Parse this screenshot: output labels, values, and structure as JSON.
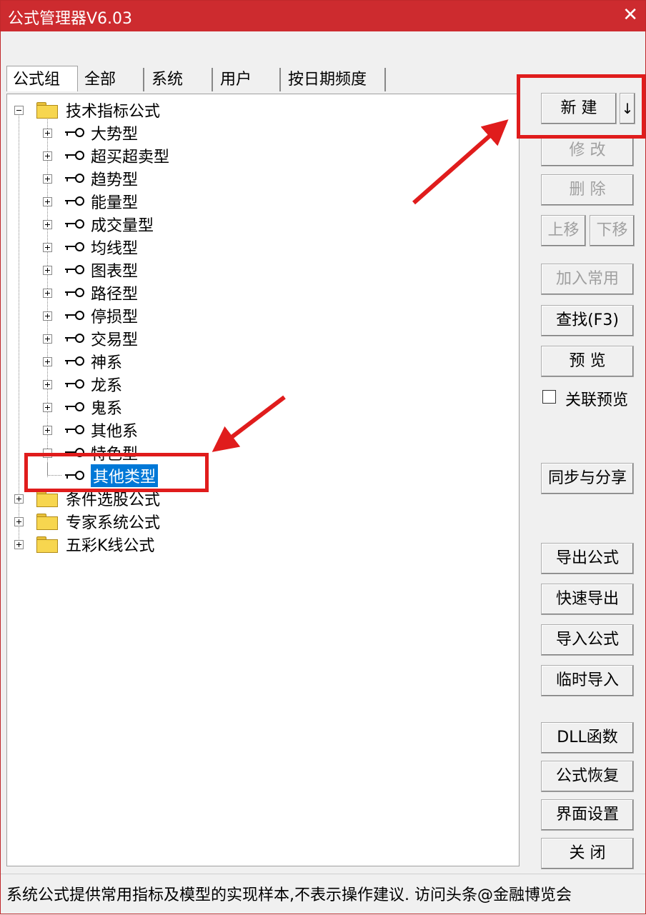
{
  "window": {
    "title": "公式管理器V6.03",
    "close_symbol": "✕"
  },
  "tabs": [
    {
      "label": "公式组",
      "active": true
    },
    {
      "label": "全部"
    },
    {
      "label": "系统"
    },
    {
      "label": "用户"
    },
    {
      "label": "按日期频度"
    }
  ],
  "tree": {
    "root_technical": "技术指标公式",
    "children": [
      "大势型",
      "超买超卖型",
      "趋势型",
      "能量型",
      "成交量型",
      "均线型",
      "图表型",
      "路径型",
      "停损型",
      "交易型",
      "神系",
      "龙系",
      "鬼系",
      "其他系",
      "特色型"
    ],
    "selected_child": "其他类型",
    "other_roots": [
      "条件选股公式",
      "专家系统公式",
      "五彩K线公式"
    ]
  },
  "buttons": {
    "new": "新  建",
    "new_dropdown": "↓",
    "modify": "修  改",
    "delete": "删  除",
    "move_up": "上移",
    "move_down": "下移",
    "add_common": "加入常用",
    "find": "查找(F3)",
    "preview": "预  览",
    "linked_preview": "关联预览",
    "sync_share": "同步与分享",
    "export_formula": "导出公式",
    "quick_export": "快速导出",
    "import_formula": "导入公式",
    "temp_import": "临时导入",
    "dll_function": "DLL函数",
    "formula_restore": "公式恢复",
    "ui_settings": "界面设置",
    "close": "关  闭"
  },
  "status": {
    "text": "系统公式提供常用指标及模型的实现样本,不表示操作建议.  访问头条@金融博览会"
  },
  "colors": {
    "title_bar": "#cd2b2f",
    "selection": "#0078d7",
    "annotation": "#e01c1c"
  }
}
